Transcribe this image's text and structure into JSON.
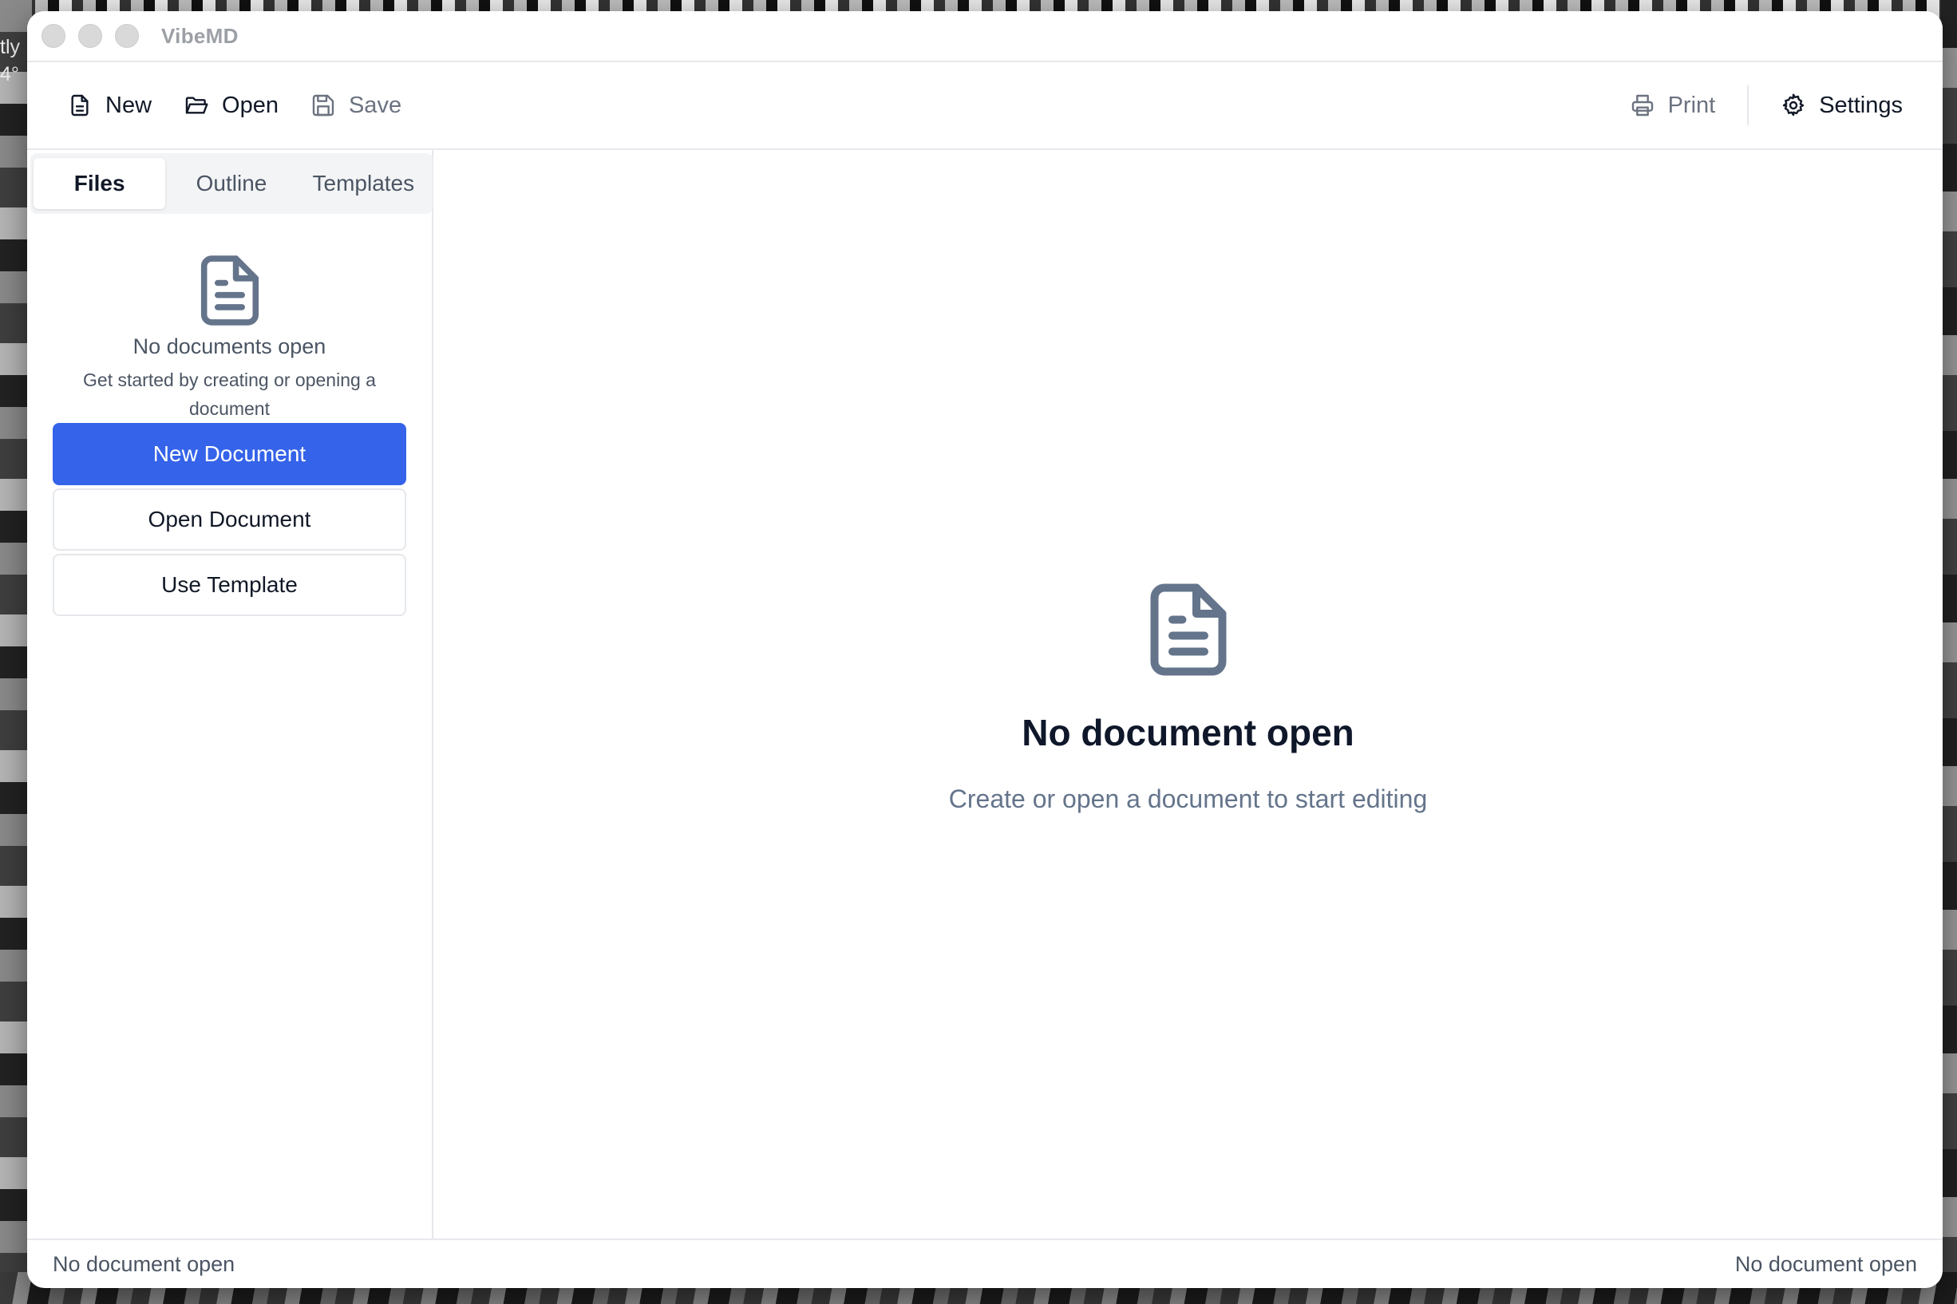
{
  "desktop": {
    "widget_line1": "tly",
    "widget_line2": "4°"
  },
  "window": {
    "title": "VibeMD"
  },
  "toolbar": {
    "new_label": "New",
    "open_label": "Open",
    "save_label": "Save",
    "print_label": "Print",
    "settings_label": "Settings"
  },
  "sidebar": {
    "tabs": [
      {
        "label": "Files",
        "active": true
      },
      {
        "label": "Outline",
        "active": false
      },
      {
        "label": "Templates",
        "active": false
      }
    ],
    "empty_title": "No documents open",
    "empty_subtitle": "Get started by creating or opening a document",
    "buttons": {
      "new_document": "New Document",
      "open_document": "Open Document",
      "use_template": "Use Template"
    }
  },
  "main": {
    "empty_title": "No document open",
    "empty_subtitle": "Create or open a document to start editing"
  },
  "status": {
    "left": "No document open",
    "right": "No document open"
  },
  "colors": {
    "accent": "#3563e9",
    "icon_gray": "#64748b"
  },
  "icons": [
    "file-icon",
    "folder-open-icon",
    "save-icon",
    "printer-icon",
    "gear-icon",
    "document-icon"
  ]
}
